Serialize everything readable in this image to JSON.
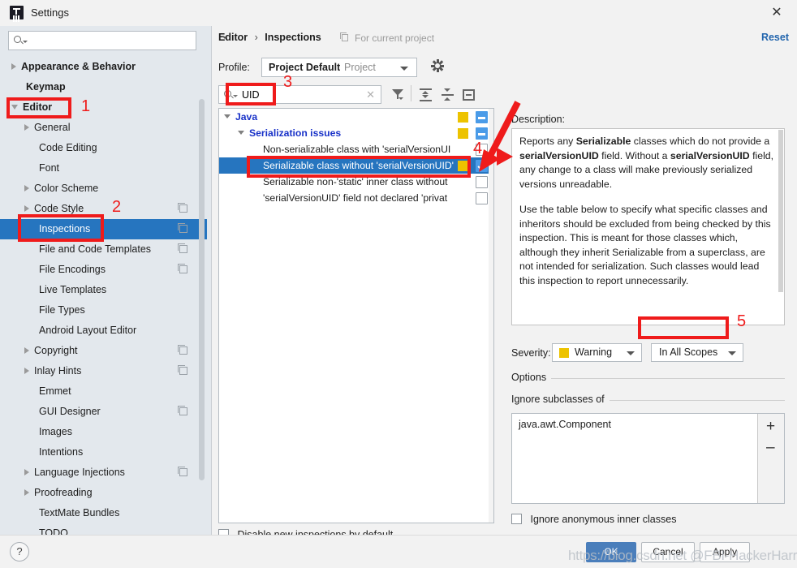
{
  "window": {
    "title": "Settings",
    "icon": "intellij-idea-icon",
    "close_label": "✕"
  },
  "sidebar": {
    "search": {
      "value": "",
      "placeholder": ""
    },
    "items": [
      {
        "label": "Appearance & Behavior",
        "arrow": "right",
        "bold": true,
        "indent": false,
        "copy": false,
        "selected": false
      },
      {
        "label": "Keymap",
        "arrow": "none",
        "bold": true,
        "indent": false,
        "copy": false,
        "selected": false
      },
      {
        "label": "Editor",
        "arrow": "down",
        "bold": true,
        "indent": false,
        "copy": false,
        "selected": false
      },
      {
        "label": "General",
        "arrow": "right",
        "bold": false,
        "indent": true,
        "copy": false,
        "selected": false
      },
      {
        "label": "Code Editing",
        "arrow": "none",
        "bold": false,
        "indent": true,
        "copy": false,
        "selected": false
      },
      {
        "label": "Font",
        "arrow": "none",
        "bold": false,
        "indent": true,
        "copy": false,
        "selected": false
      },
      {
        "label": "Color Scheme",
        "arrow": "right",
        "bold": false,
        "indent": true,
        "copy": false,
        "selected": false
      },
      {
        "label": "Code Style",
        "arrow": "right",
        "bold": false,
        "indent": true,
        "copy": true,
        "selected": false
      },
      {
        "label": "Inspections",
        "arrow": "none",
        "bold": false,
        "indent": true,
        "copy": true,
        "selected": true
      },
      {
        "label": "File and Code Templates",
        "arrow": "none",
        "bold": false,
        "indent": true,
        "copy": true,
        "selected": false
      },
      {
        "label": "File Encodings",
        "arrow": "none",
        "bold": false,
        "indent": true,
        "copy": true,
        "selected": false
      },
      {
        "label": "Live Templates",
        "arrow": "none",
        "bold": false,
        "indent": true,
        "copy": false,
        "selected": false
      },
      {
        "label": "File Types",
        "arrow": "none",
        "bold": false,
        "indent": true,
        "copy": false,
        "selected": false
      },
      {
        "label": "Android Layout Editor",
        "arrow": "none",
        "bold": false,
        "indent": true,
        "copy": false,
        "selected": false
      },
      {
        "label": "Copyright",
        "arrow": "right",
        "bold": false,
        "indent": true,
        "copy": true,
        "selected": false
      },
      {
        "label": "Inlay Hints",
        "arrow": "right",
        "bold": false,
        "indent": true,
        "copy": true,
        "selected": false
      },
      {
        "label": "Emmet",
        "arrow": "none",
        "bold": false,
        "indent": true,
        "copy": false,
        "selected": false
      },
      {
        "label": "GUI Designer",
        "arrow": "none",
        "bold": false,
        "indent": true,
        "copy": true,
        "selected": false
      },
      {
        "label": "Images",
        "arrow": "none",
        "bold": false,
        "indent": true,
        "copy": false,
        "selected": false
      },
      {
        "label": "Intentions",
        "arrow": "none",
        "bold": false,
        "indent": true,
        "copy": false,
        "selected": false
      },
      {
        "label": "Language Injections",
        "arrow": "right",
        "bold": false,
        "indent": true,
        "copy": true,
        "selected": false
      },
      {
        "label": "Proofreading",
        "arrow": "right",
        "bold": false,
        "indent": true,
        "copy": false,
        "selected": false
      },
      {
        "label": "TextMate Bundles",
        "arrow": "none",
        "bold": false,
        "indent": true,
        "copy": false,
        "selected": false
      },
      {
        "label": "TODO",
        "arrow": "none",
        "bold": false,
        "indent": true,
        "copy": false,
        "selected": false
      }
    ]
  },
  "header": {
    "breadcrumb_parent": "Editor",
    "breadcrumb_sep": "›",
    "breadcrumb_current": "Inspections",
    "for_current_project": "For current project",
    "reset_label": "Reset"
  },
  "profile": {
    "label": "Profile:",
    "selected_name": "Project Default",
    "selected_scope": "Project",
    "gear_icon": "gear-icon"
  },
  "toolbar": {
    "search_value": "UID",
    "search_placeholder": "",
    "clear_label": "✕",
    "filter_icon": "filter-funnel-icon",
    "expand_all_icon": "expand-all-icon",
    "collapse_all_icon": "collapse-all-icon",
    "minimize_icon": "minimize-icon"
  },
  "inspection_tree": [
    {
      "label": "Java",
      "type": "group",
      "depth": 0,
      "arrow": true,
      "severity": "warning",
      "check": "partial",
      "selected": false
    },
    {
      "label": "Serialization issues",
      "type": "group",
      "depth": 1,
      "arrow": true,
      "severity": "warning",
      "check": "partial",
      "selected": false
    },
    {
      "label": "Non-serializable class with 'serialVersionUI",
      "type": "item",
      "depth": 2,
      "arrow": false,
      "severity": "none",
      "check": "off",
      "selected": false
    },
    {
      "label": "Serializable class without 'serialVersionUID'",
      "type": "item",
      "depth": 2,
      "arrow": false,
      "severity": "warning",
      "check": "on",
      "selected": true
    },
    {
      "label": "Serializable non-'static' inner class without",
      "type": "item",
      "depth": 2,
      "arrow": false,
      "severity": "none",
      "check": "off",
      "selected": false
    },
    {
      "label": "'serialVersionUID' field not declared 'privat",
      "type": "item",
      "depth": 2,
      "arrow": false,
      "severity": "none",
      "check": "off",
      "selected": false
    }
  ],
  "tree_footer": {
    "disable_new_label": "Disable new inspections by default",
    "disable_new_checked": false
  },
  "description": {
    "label": "Description:",
    "paragraph1_pre": "Reports any ",
    "paragraph1_b1": "Serializable",
    "paragraph1_mid1": " classes which do not provide a ",
    "paragraph1_b2": "serialVersionUID",
    "paragraph1_mid2": " field. Without a ",
    "paragraph1_b3": "serialVersionUID",
    "paragraph1_end": " field, any change to a class will make previously serialized versions unreadable.",
    "paragraph2": "Use the table below to specify what specific classes and inheritors should be excluded from being checked by this inspection. This is meant for those classes which, although they inherit Serializable from a superclass, are not intended for serialization. Such classes would lead this inspection to report unnecessarily."
  },
  "settings": {
    "severity_label": "Severity:",
    "severity_value": "Warning",
    "severity_color": "#edc300",
    "scope_value": "In All Scopes",
    "options_label": "Options",
    "ignore_subclasses_label": "Ignore subclasses of",
    "ignore_list": [
      "java.awt.Component"
    ],
    "add_label": "+",
    "remove_label": "–",
    "ignore_anonymous_label": "Ignore anonymous inner classes",
    "ignore_anonymous_checked": false
  },
  "footer": {
    "help_label": "?",
    "ok_label": "OK",
    "cancel_label": "Cancel",
    "apply_label": "Apply",
    "watermark": "https://blog.csdn.net @FBI-HackerHarry浩"
  },
  "annotations": {
    "markers": [
      "1",
      "2",
      "3",
      "4",
      "5"
    ],
    "color": "#ef1b1b"
  }
}
